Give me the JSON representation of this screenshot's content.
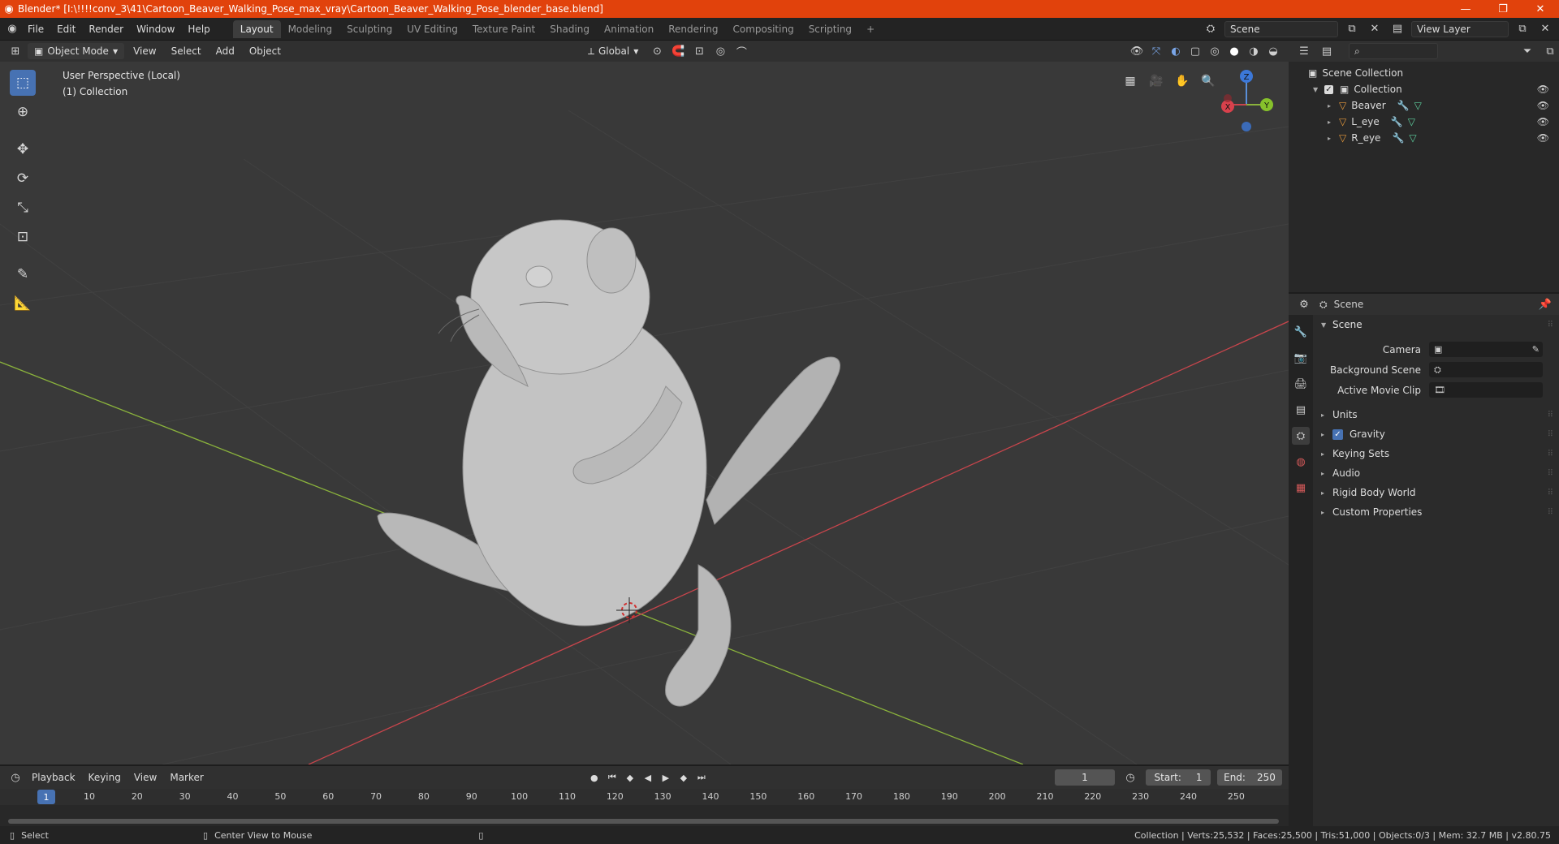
{
  "titlebar": {
    "title": "Blender* [I:\\!!!!conv_3\\41\\Cartoon_Beaver_Walking_Pose_max_vray\\Cartoon_Beaver_Walking_Pose_blender_base.blend]",
    "minimize": "—",
    "maximize": "❐",
    "close": "✕"
  },
  "menubar": {
    "items": [
      "File",
      "Edit",
      "Render",
      "Window",
      "Help"
    ],
    "workspaces": [
      "Layout",
      "Modeling",
      "Sculpting",
      "UV Editing",
      "Texture Paint",
      "Shading",
      "Animation",
      "Rendering",
      "Compositing",
      "Scripting"
    ],
    "active_workspace": "Layout",
    "add_tab": "+",
    "scene": "Scene",
    "view_layer": "View Layer"
  },
  "viewport_header": {
    "mode": "Object Mode",
    "menus": [
      "View",
      "Select",
      "Add",
      "Object"
    ],
    "orientation": "Global"
  },
  "viewport": {
    "perspective": "User Perspective (Local)",
    "collection": "(1) Collection",
    "gizmo_axes": {
      "z": "Z",
      "x": "X",
      "y": "Y"
    }
  },
  "outliner": {
    "root": "Scene Collection",
    "collection": "Collection",
    "objects": [
      "Beaver",
      "L_eye",
      "R_eye"
    ]
  },
  "properties": {
    "context": "Scene",
    "panel": "Scene",
    "fields": {
      "camera": "Camera",
      "background_scene": "Background Scene",
      "active_movie_clip": "Active Movie Clip"
    },
    "subpanels": [
      "Units",
      "Gravity",
      "Keying Sets",
      "Audio",
      "Rigid Body World",
      "Custom Properties"
    ]
  },
  "timeline": {
    "menus": [
      "Playback",
      "Keying",
      "View",
      "Marker"
    ],
    "current_frame": "1",
    "start_label": "Start:",
    "start": "1",
    "end_label": "End:",
    "end": "250",
    "ticks": [
      "10",
      "20",
      "30",
      "40",
      "50",
      "60",
      "70",
      "80",
      "90",
      "100",
      "110",
      "120",
      "130",
      "140",
      "150",
      "160",
      "170",
      "180",
      "190",
      "200",
      "210",
      "220",
      "230",
      "240",
      "250"
    ]
  },
  "statusbar": {
    "left1": "Select",
    "left2": "Center View to Mouse",
    "stats": "Collection | Verts:25,532 | Faces:25,500 | Tris:51,000 | Objects:0/3 | Mem: 32.7 MB | v2.80.75"
  },
  "colors": {
    "titlebar": "#e1420c",
    "accent": "#4772b3",
    "viewport_bg": "#393939",
    "axis_x": "#c9454c",
    "axis_y": "#8ab23c"
  }
}
